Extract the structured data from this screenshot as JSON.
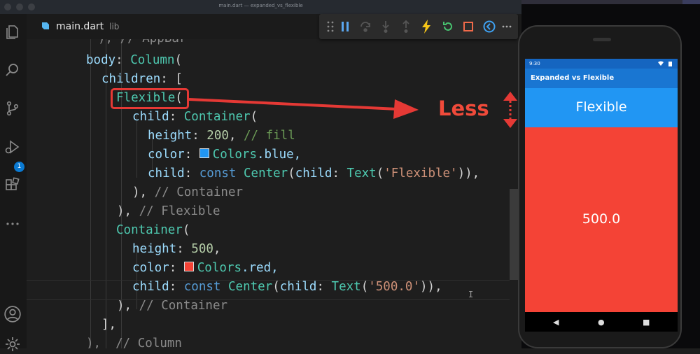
{
  "window": {
    "title": "main.dart — expanded_vs_flexible"
  },
  "tab": {
    "filename": "main.dart",
    "folder": "lib"
  },
  "activity": {
    "debug_badge": "1"
  },
  "code": {
    "l0": {
      "a": "), // AppBar"
    },
    "l1": {
      "a": "body",
      "b": ": ",
      "c": "Column",
      "d": "("
    },
    "l2": {
      "a": "children",
      "b": ": ["
    },
    "l3": {
      "a": "Flexible",
      "b": "("
    },
    "l4": {
      "a": "child",
      "b": ": ",
      "c": "Container",
      "d": "("
    },
    "l5": {
      "a": "height",
      "b": ": ",
      "c": "200",
      "d": ", ",
      "e": "// fill"
    },
    "l6": {
      "a": "color",
      "b": ": ",
      "c": "Colors",
      "d": ".blue,"
    },
    "l7": {
      "a": "child",
      "b": ": ",
      "c": "const",
      "d": " ",
      "e": "Center",
      "f": "(",
      "g": "child",
      "h": ": ",
      "i": "Text",
      "j": "(",
      "k": "'Flexible'",
      "l": ")),"
    },
    "l8": {
      "a": "), ",
      "b": "// Container"
    },
    "l9": {
      "a": "), ",
      "b": "// Flexible"
    },
    "l10": {
      "a": "Container",
      "b": "("
    },
    "l11": {
      "a": "height",
      "b": ": ",
      "c": "500",
      "d": ","
    },
    "l12": {
      "a": "color",
      "b": ": ",
      "c": "Colors",
      "d": ".red,"
    },
    "l13": {
      "a": "child",
      "b": ": ",
      "c": "const",
      "d": " ",
      "e": "Center",
      "f": "(",
      "g": "child",
      "h": ": ",
      "i": "Text",
      "j": "(",
      "k": "'500.0'",
      "l": ")),"
    },
    "l14": {
      "a": "), ",
      "b": "// Container"
    },
    "l15": {
      "a": "],"
    },
    "l16": {
      "a": "),  // Column"
    }
  },
  "annotation": {
    "label": "Less"
  },
  "phone": {
    "time": "9:30",
    "app_title": "Expanded vs Flexible",
    "flexible_text": "Flexible",
    "red_text": "500.0",
    "nav_back": "◀",
    "nav_home": "●",
    "nav_recent": "■"
  },
  "colors": {
    "blue": "#2196f3",
    "red": "#f44336",
    "appbar": "#1976d2",
    "annotation": "#e53935"
  }
}
